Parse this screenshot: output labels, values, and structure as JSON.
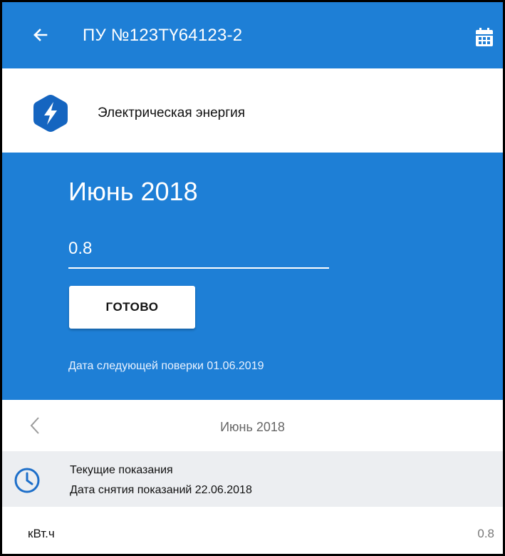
{
  "header": {
    "title": "ПУ №123ТҮ64123-2",
    "back_icon": "arrow-left-icon",
    "calendar_icon": "calendar-icon",
    "color": "#1e7fd6"
  },
  "category": {
    "label": "Электрическая энергия",
    "icon": "lightning-bolt-icon",
    "icon_color": "#1565c0"
  },
  "entry": {
    "month": "Июнь 2018",
    "reading_value": "0.8",
    "done_label": "ГОТОВО",
    "next_verification": "Дата следующей поверки 01.06.2019"
  },
  "month_nav": {
    "prev_icon": "chevron-left-icon",
    "label": "Июнь 2018"
  },
  "status": {
    "icon": "clock-icon",
    "title": "Текущие показания",
    "date_text": "Дата снятия показаний 22.06.2018"
  },
  "reading_row": {
    "unit": "кВт.ч",
    "value": "0.8"
  }
}
